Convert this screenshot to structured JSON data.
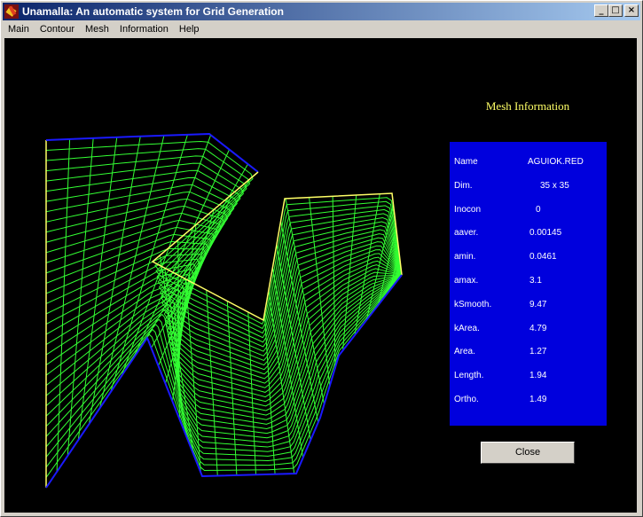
{
  "window": {
    "title": "Unamalla: An automatic system for Grid Generation",
    "controls": {
      "minimize": "_",
      "maximize": "□",
      "close": "×"
    }
  },
  "menu": [
    {
      "label": "Main"
    },
    {
      "label": "Contour"
    },
    {
      "label": "Mesh"
    },
    {
      "label": "Information"
    },
    {
      "label": "Help"
    }
  ],
  "mesh_view": {
    "grid_color": "#33ff33",
    "boundary_yellow": "#ffff66",
    "boundary_blue": "#1a1aff",
    "background": "#000000"
  },
  "info": {
    "title": "Mesh Information",
    "panel_color": "#0000dd",
    "rows": [
      {
        "label": "Name",
        "value": "AGUIOK.RED"
      },
      {
        "label": "Dim.",
        "value": "35 x 35"
      },
      {
        "label": "Inocon",
        "value": "0"
      },
      {
        "label": "aaver.",
        "value": "0.00145"
      },
      {
        "label": "amin.",
        "value": "0.0461"
      },
      {
        "label": "amax.",
        "value": "3.1"
      },
      {
        "label": "kSmooth.",
        "value": "9.47"
      },
      {
        "label": "kArea.",
        "value": "4.79"
      },
      {
        "label": "Area.",
        "value": "1.27"
      },
      {
        "label": "Length.",
        "value": "1.94"
      },
      {
        "label": "Ortho.",
        "value": "1.49"
      }
    ],
    "close_label": "Close"
  }
}
